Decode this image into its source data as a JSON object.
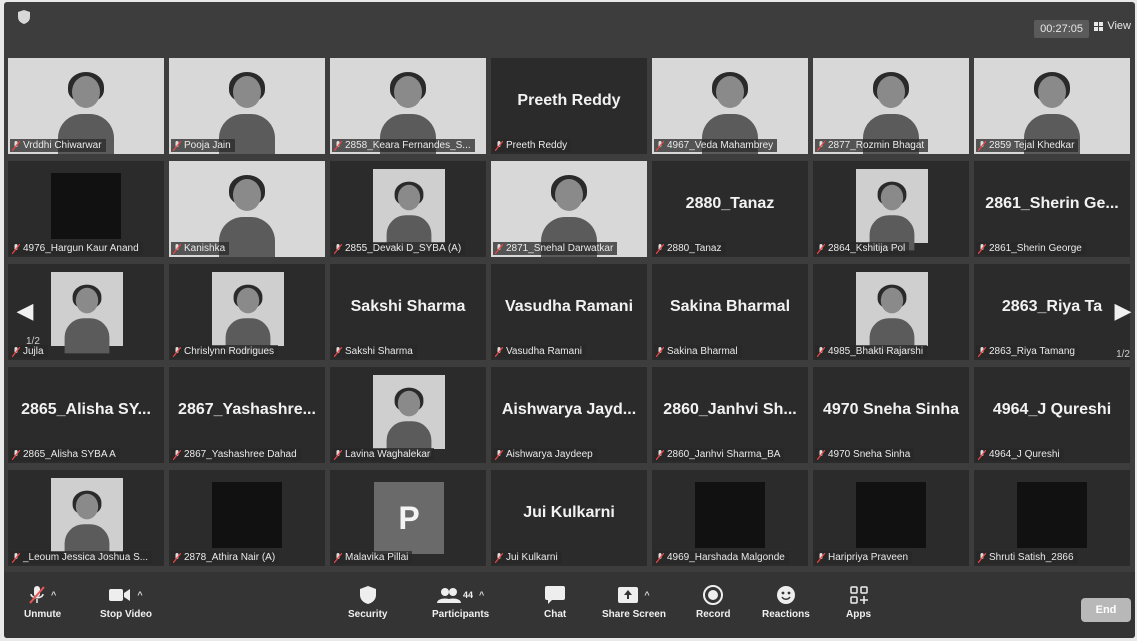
{
  "window": {
    "timer": "00:27:05",
    "view_label": "View"
  },
  "gallery": {
    "page_left": "1/2",
    "page_right": "1/2",
    "tiles": [
      {
        "label": "Vrddhi Chiwarwar",
        "display_name": "",
        "kind": "video"
      },
      {
        "label": "Pooja Jain",
        "display_name": "",
        "kind": "video"
      },
      {
        "label": "2858_Keara Fernandes_S...",
        "display_name": "",
        "kind": "video"
      },
      {
        "label": "Preeth Reddy",
        "display_name": "Preeth Reddy",
        "kind": "name"
      },
      {
        "label": "4967_Veda Mahambrey",
        "display_name": "",
        "kind": "video"
      },
      {
        "label": "2877_Rozmin Bhagat",
        "display_name": "",
        "kind": "video"
      },
      {
        "label": "2859 Tejal Khedkar",
        "display_name": "",
        "kind": "video"
      },
      {
        "label": "4976_Hargun Kaur Anand",
        "display_name": "",
        "kind": "dark"
      },
      {
        "label": "Kanishka",
        "display_name": "",
        "kind": "video"
      },
      {
        "label": "2855_Devaki D_SYBA (A)",
        "display_name": "",
        "kind": "inner"
      },
      {
        "label": "2871_Snehal Darwatkar",
        "display_name": "",
        "kind": "video"
      },
      {
        "label": "2880_Tanaz",
        "display_name": "2880_Tanaz",
        "kind": "name"
      },
      {
        "label": "2864_Kshitija Pol",
        "display_name": "",
        "kind": "inner"
      },
      {
        "label": "2861_Sherin George",
        "display_name": "2861_Sherin Ge...",
        "kind": "name"
      },
      {
        "label": "Jujla",
        "display_name": "",
        "kind": "inner"
      },
      {
        "label": "Chrislynn Rodrigues",
        "display_name": "",
        "kind": "inner"
      },
      {
        "label": "Sakshi Sharma",
        "display_name": "Sakshi Sharma",
        "kind": "name"
      },
      {
        "label": "Vasudha Ramani",
        "display_name": "Vasudha Ramani",
        "kind": "name"
      },
      {
        "label": "Sakina Bharmal",
        "display_name": "Sakina Bharmal",
        "kind": "name"
      },
      {
        "label": "4985_Bhakti Rajarshi",
        "display_name": "",
        "kind": "inner"
      },
      {
        "label": "2863_Riya Tamang",
        "display_name": "2863_Riya Ta",
        "kind": "name"
      },
      {
        "label": "2865_Alisha SYBA A",
        "display_name": "2865_Alisha SY...",
        "kind": "name"
      },
      {
        "label": "2867_Yashashree Dahad",
        "display_name": "2867_Yashashre...",
        "kind": "name"
      },
      {
        "label": "Lavina Waghalekar",
        "display_name": "",
        "kind": "inner"
      },
      {
        "label": "Aishwarya Jaydeep",
        "display_name": "Aishwarya Jayd...",
        "kind": "name"
      },
      {
        "label": "2860_Janhvi Sharma_BA",
        "display_name": "2860_Janhvi Sh...",
        "kind": "name"
      },
      {
        "label": "4970 Sneha Sinha",
        "display_name": "4970 Sneha Sinha",
        "kind": "name"
      },
      {
        "label": "4964_J Qureshi",
        "display_name": "4964_J Qureshi",
        "kind": "name"
      },
      {
        "label": "_Leoum Jessica Joshua S...",
        "display_name": "",
        "kind": "inner"
      },
      {
        "label": "2878_Athira Nair (A)",
        "display_name": "",
        "kind": "dark"
      },
      {
        "label": "Malavika Pillai",
        "display_name": "P",
        "kind": "avatar"
      },
      {
        "label": "Jui Kulkarni",
        "display_name": "Jui Kulkarni",
        "kind": "name"
      },
      {
        "label": "4969_Harshada Malgonde",
        "display_name": "",
        "kind": "dark"
      },
      {
        "label": "Haripriya Praveen",
        "display_name": "",
        "kind": "dark"
      },
      {
        "label": "Shruti Satish_2866",
        "display_name": "",
        "kind": "dark"
      }
    ]
  },
  "toolbar": {
    "unmute": "Unmute",
    "stop_video": "Stop Video",
    "security": "Security",
    "participants": "Participants",
    "participants_count": "44",
    "chat": "Chat",
    "share_screen": "Share Screen",
    "record": "Record",
    "reactions": "Reactions",
    "apps": "Apps",
    "end": "End"
  }
}
